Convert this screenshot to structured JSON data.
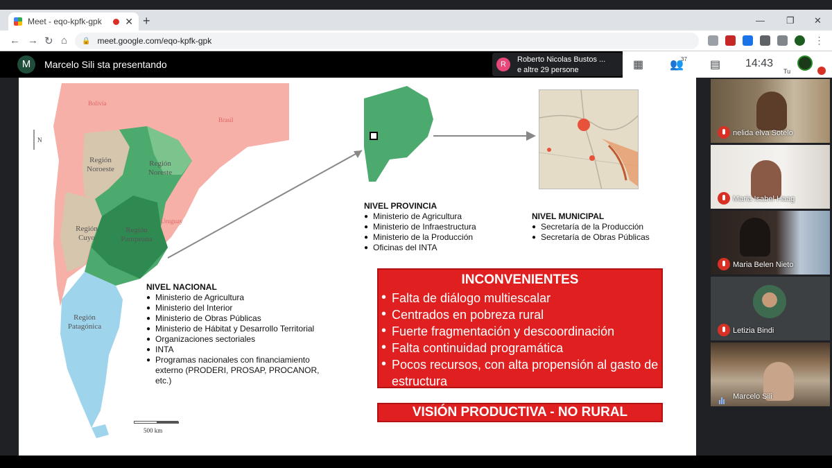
{
  "browser": {
    "tab_title": "Meet - eqo-kpfk-gpk",
    "tab_close": "✕",
    "new_tab": "+",
    "url": "meet.google.com/eqo-kpfk-gpk",
    "win_min": "—",
    "win_restore": "❐",
    "win_close": "✕",
    "nav_back": "←",
    "nav_forward": "→",
    "nav_reload": "↻",
    "nav_home": "⌂",
    "lock_icon": "🔒"
  },
  "meet": {
    "presenter_initial": "M",
    "presenter_text": "Marcelo Sili sta presentando",
    "participant_initial": "R",
    "participant_name": "Roberto Nicolas Bustos ...",
    "participant_more": "e altre 29 persone",
    "people_count": "37",
    "clock": "14:43",
    "self_label": "Tu"
  },
  "slide": {
    "map": {
      "north": "N",
      "regions": [
        "Región Noroeste",
        "Región Noreste",
        "Región Cuyo",
        "Región Pampeana",
        "Región Patagónica"
      ],
      "countries": [
        "Bolivia",
        "Brasil",
        "Uruguay"
      ],
      "scale_label": "500 km"
    },
    "nacional": {
      "title": "NIVEL NACIONAL",
      "items": [
        "Ministerio de Agricultura",
        "Ministerio del Interior",
        "Ministerio de Obras Públicas",
        "Ministerio de Hábitat y Desarrollo Territorial",
        "Organizaciones sectoriales",
        "INTA",
        "Programas nacionales con financiamiento externo (PRODERI, PROSAP, PROCANOR, etc.)"
      ]
    },
    "provincia": {
      "title": "NIVEL PROVINCIA",
      "items": [
        "Ministerio de Agricultura",
        "Ministerio de Infraestructura",
        "Ministerio de la Producción",
        "Oficinas del INTA"
      ]
    },
    "municipal": {
      "title": "NIVEL MUNICIPAL",
      "items": [
        "Secretaría de la Producción",
        "Secretaría de Obras Públicas"
      ]
    },
    "inconvenientes": {
      "title": "INCONVENIENTES",
      "items": [
        "Falta de diálogo multiescalar",
        "Centrados en pobreza rural",
        "Fuerte fragmentación y descoordinación",
        "Falta continuidad programática",
        "Pocos recursos, con alta propensión al gasto de estructura"
      ]
    },
    "vision": "VISIÓN PRODUCTIVA - NO RURAL",
    "colors": {
      "argentina_green": "#4daa6e",
      "neighbour_pink": "#f6b0a8",
      "patagonia_blue": "#9ed4ec",
      "tan": "#d7c6ae",
      "alert_red": "#e02020"
    }
  },
  "tiles": [
    {
      "name": "nelida elva Sotelo",
      "muted": true
    },
    {
      "name": "Maria Isabel Haag",
      "muted": true
    },
    {
      "name": "Maria Belen Nieto",
      "muted": true
    },
    {
      "name": "Letizia Bindi",
      "muted": true
    },
    {
      "name": "Marcelo Sili",
      "muted": false
    }
  ]
}
